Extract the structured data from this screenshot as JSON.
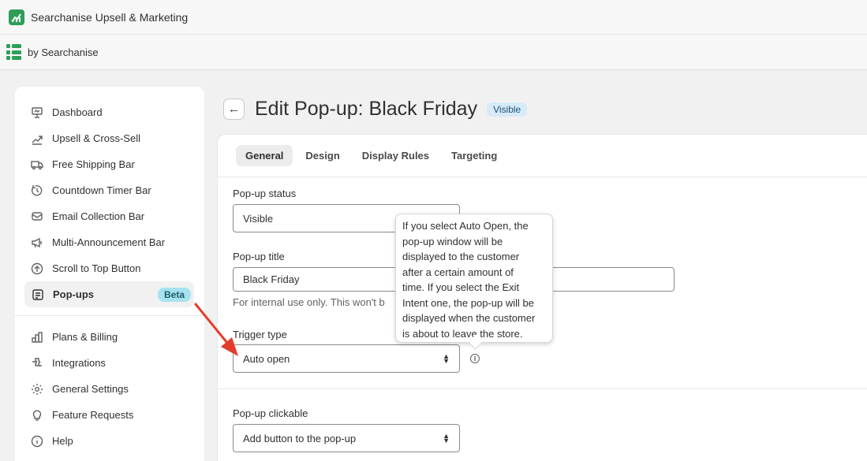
{
  "app": {
    "title": "Searchanise Upsell & Marketing",
    "by": "by Searchanise"
  },
  "sidebar": {
    "items": [
      {
        "label": "Dashboard",
        "icon": "presentation-icon"
      },
      {
        "label": "Upsell & Cross-Sell",
        "icon": "upsell-chart-icon"
      },
      {
        "label": "Free Shipping Bar",
        "icon": "truck-icon"
      },
      {
        "label": "Countdown Timer Bar",
        "icon": "timer-icon"
      },
      {
        "label": "Email Collection Bar",
        "icon": "email-icon"
      },
      {
        "label": "Multi-Announcement Bar",
        "icon": "megaphone-icon"
      },
      {
        "label": "Scroll to Top Button",
        "icon": "arrow-up-circle-icon"
      },
      {
        "label": "Pop-ups",
        "icon": "popup-icon",
        "badge": "Beta",
        "active": true
      },
      {
        "label": "Plans & Billing",
        "icon": "plans-icon"
      },
      {
        "label": "Integrations",
        "icon": "integrations-icon"
      },
      {
        "label": "General Settings",
        "icon": "gear-icon"
      },
      {
        "label": "Feature Requests",
        "icon": "lightbulb-icon"
      },
      {
        "label": "Help",
        "icon": "info-circle-icon"
      }
    ]
  },
  "page": {
    "title": "Edit Pop-up: Black Friday",
    "status_badge": "Visible"
  },
  "tabs": [
    "General",
    "Design",
    "Display Rules",
    "Targeting"
  ],
  "form": {
    "status": {
      "label": "Pop-up status",
      "value": "Visible"
    },
    "title": {
      "label": "Pop-up title",
      "value": "Black Friday",
      "help": "For internal use only. This won't b"
    },
    "trigger": {
      "label": "Trigger type",
      "value": "Auto open"
    },
    "clickable": {
      "label": "Pop-up clickable",
      "value": "Add button to the pop-up"
    }
  },
  "tooltip": {
    "lines": [
      "If you select Auto Open, the",
      "pop-up window will be",
      "displayed to the customer",
      "after a certain amount of",
      "time. If you select the Exit",
      "Intent one, the pop-up will be",
      "displayed when the customer",
      "is about to leave the store."
    ]
  },
  "colors": {
    "brand_green": "#2e9e5b",
    "annotation_arrow": "#e53b2c",
    "beta_badge": "#a6e3ef",
    "visible_badge": "#d5ebf7"
  }
}
